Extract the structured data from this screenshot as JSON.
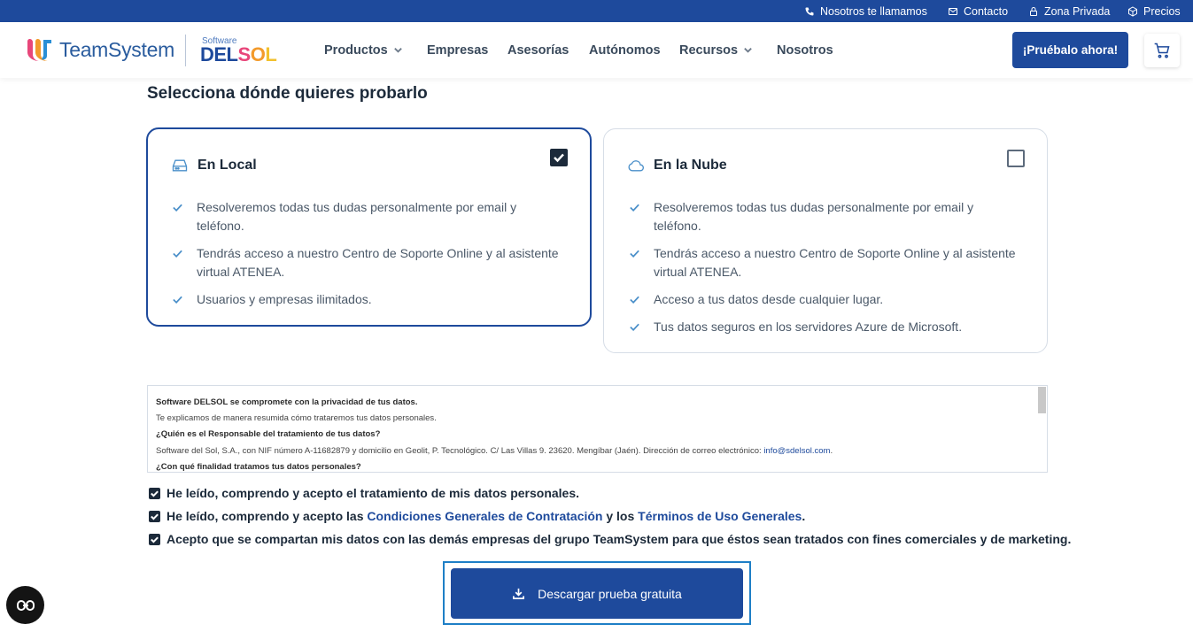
{
  "topbar": {
    "call_label": "Nosotros te llamamos",
    "contact_label": "Contacto",
    "private_label": "Zona Privada",
    "prices_label": "Precios"
  },
  "header": {
    "logo_teamsystem": "TeamSystem",
    "logo_software": "Software",
    "logo_delsol": "DELSOL",
    "nav": {
      "productos": "Productos",
      "empresas": "Empresas",
      "asesorias": "Asesorías",
      "autonomos": "Autónomos",
      "recursos": "Recursos",
      "nosotros": "Nosotros"
    },
    "cta_label": "¡Pruébalo ahora!"
  },
  "main": {
    "section_title": "Selecciona dónde quieres probarlo",
    "local": {
      "title": "En Local",
      "checked": true,
      "items": [
        "Resolveremos todas tus dudas personalmente por email y teléfono.",
        "Tendrás acceso a nuestro Centro de Soporte Online y al asistente virtual ATENEA.",
        "Usuarios y empresas ilimitados."
      ]
    },
    "cloud": {
      "title": "En la Nube",
      "checked": false,
      "items": [
        "Resolveremos todas tus dudas personalmente por email y teléfono.",
        "Tendrás acceso a nuestro Centro de Soporte Online y al asistente virtual ATENEA.",
        "Acceso a tus datos desde cualquier lugar.",
        "Tus datos seguros en los servidores Azure de Microsoft."
      ]
    },
    "privacy": {
      "line1": "Software DELSOL se compromete con la privacidad de tus datos.",
      "line2": "Te explicamos de manera resumida cómo trataremos tus datos personales.",
      "line3": "¿Quién es el Responsable del tratamiento de tus datos?",
      "line4_text": "Software del Sol, S.A., con NIF número A-11682879 y domicilio en Geolit, P. Tecnológico. C/ Las Villas 9. 23620. Mengíbar (Jaén). Dirección de correo electrónico: ",
      "line4_email": "info@sdelsol.com",
      "line4_end": ".",
      "line5": "¿Con qué finalidad tratamos tus datos personales?"
    },
    "consents": {
      "c1": "He leído, comprendo y acepto el tratamiento de mis datos personales.",
      "c2_a": "He leído, comprendo y acepto las ",
      "c2_link1": "Condiciones Generales de Contratación",
      "c2_b": " y los ",
      "c2_link2": "Términos de Uso Generales",
      "c2_c": ".",
      "c3": "Acepto que se compartan mis datos con las demás empresas del grupo TeamSystem para que éstos sean tratados con fines comerciales y de marketing."
    },
    "download_label": "Descargar prueba gratuita"
  },
  "colors": {
    "brand_blue": "#1e4a9c",
    "accent_light_blue": "#4a8fc9",
    "text_dark": "#1c2a3a"
  },
  "icons": {
    "topbar": [
      "phone-icon",
      "mail-icon",
      "lock-icon",
      "box-icon"
    ],
    "header": [
      "chevron-down-icon",
      "cart-icon"
    ],
    "cards": [
      "hard-drive-icon",
      "cloud-icon",
      "check-icon"
    ],
    "footer": [
      "download-icon",
      "accessibility-icon"
    ]
  }
}
